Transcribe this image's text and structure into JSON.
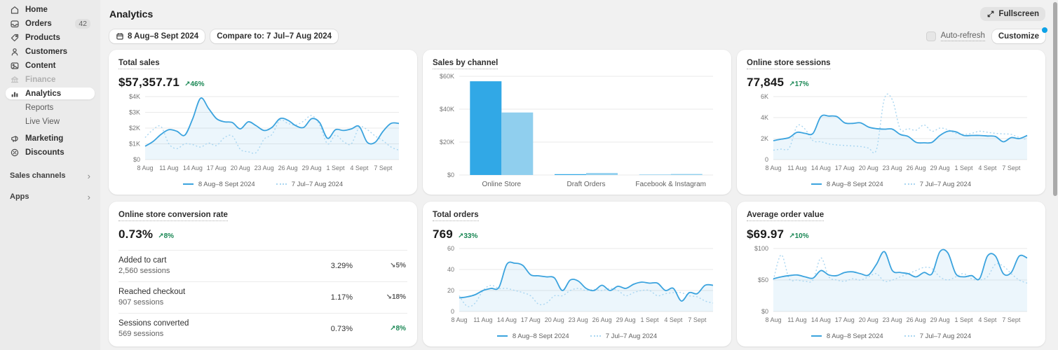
{
  "sidebar": {
    "items": [
      {
        "label": "Home"
      },
      {
        "label": "Orders",
        "badge": "42"
      },
      {
        "label": "Products"
      },
      {
        "label": "Customers"
      },
      {
        "label": "Content"
      },
      {
        "label": "Finance"
      },
      {
        "label": "Analytics"
      },
      {
        "label": "Reports"
      },
      {
        "label": "Live View"
      },
      {
        "label": "Marketing"
      },
      {
        "label": "Discounts"
      }
    ],
    "sections": [
      {
        "label": "Sales channels"
      },
      {
        "label": "Apps"
      }
    ]
  },
  "header": {
    "title": "Analytics",
    "fullscreen_label": "Fullscreen"
  },
  "toolbar": {
    "date_range": "8 Aug–8 Sept 2024",
    "compare_label": "Compare to: 7 Jul–7 Aug 2024",
    "auto_refresh_label": "Auto-refresh",
    "customize_label": "Customize"
  },
  "cards": [
    {
      "title": "Total sales",
      "value": "$57,357.71",
      "change": "↗46%",
      "dir": "up"
    },
    {
      "title": "Sales by channel"
    },
    {
      "title": "Online store sessions",
      "value": "77,845",
      "change": "↗17%",
      "dir": "up"
    },
    {
      "title": "Online store conversion rate",
      "value": "0.73%",
      "change": "↗8%",
      "dir": "up"
    },
    {
      "title": "Total orders",
      "value": "769",
      "change": "↗33%",
      "dir": "up"
    },
    {
      "title": "Average order value",
      "value": "$69.97",
      "change": "↗10%",
      "dir": "up"
    }
  ],
  "conversion": {
    "rows": [
      {
        "label": "Added to cart",
        "sessions": "2,560 sessions",
        "rate": "3.29%",
        "change": "↘5%",
        "dir": "down"
      },
      {
        "label": "Reached checkout",
        "sessions": "907 sessions",
        "rate": "1.17%",
        "change": "↘18%",
        "dir": "down"
      },
      {
        "label": "Sessions converted",
        "sessions": "569 sessions",
        "rate": "0.73%",
        "change": "↗8%",
        "dir": "up"
      }
    ]
  },
  "chart_data": [
    {
      "type": "line",
      "title": "Total sales",
      "grid": true,
      "legend": true,
      "ymax": 4000,
      "yticks": [
        4000,
        3000,
        2000,
        1000,
        0
      ],
      "ylabels": [
        "$4K",
        "$3K",
        "$2K",
        "$1K",
        "$0"
      ],
      "x_labels": [
        "8 Aug",
        "11 Aug",
        "14 Aug",
        "17 Aug",
        "20 Aug",
        "23 Aug",
        "26 Aug",
        "29 Aug",
        "1 Sept",
        "4 Sept",
        "7 Sept"
      ],
      "colors": {
        "current": "#3ba3de",
        "previous": "#a9d6f1",
        "fill": "rgba(64,166,222,0.10)"
      },
      "series": [
        {
          "name": "8 Aug–8 Sept 2024",
          "style": "solid",
          "values": [
            850,
            1150,
            1600,
            1900,
            1800,
            1550,
            2600,
            3900,
            3250,
            2600,
            2400,
            2350,
            1950,
            2400,
            2150,
            1850,
            2050,
            2600,
            2500,
            2150,
            2050,
            2600,
            2350,
            1350,
            1900,
            1850,
            1950,
            2100,
            1100,
            1100,
            1800,
            2300,
            2300
          ]
        },
        {
          "name": "7 Jul–7 Aug 2024",
          "style": "dotted",
          "values": [
            1400,
            1900,
            2100,
            1000,
            700,
            1000,
            950,
            800,
            1050,
            900,
            1400,
            1500,
            650,
            500,
            450,
            1300,
            1600,
            2500,
            2300,
            2200,
            2450,
            2800,
            2200,
            1000,
            1550,
            1150,
            1000,
            2050,
            1900,
            1500,
            1200,
            800,
            600
          ]
        }
      ]
    },
    {
      "type": "bar",
      "title": "Sales by channel",
      "grid": true,
      "legend": false,
      "ymax": 60000,
      "yticks": [
        60000,
        40000,
        20000,
        0
      ],
      "ylabels": [
        "$60K",
        "$40K",
        "$20K",
        "$0"
      ],
      "categories": [
        "Online Store",
        "Draft Orders",
        "Facebook & Instagram"
      ],
      "colors": {
        "current": "#31a8e6",
        "previous": "#90cfee"
      },
      "series": [
        {
          "name": "8 Aug–8 Sept 2024",
          "values": [
            57000,
            500,
            150
          ]
        },
        {
          "name": "7 Jul–7 Aug 2024",
          "values": [
            38000,
            1200,
            600
          ]
        }
      ]
    },
    {
      "type": "line",
      "title": "Online store sessions",
      "grid": true,
      "legend": true,
      "ymax": 6000,
      "yticks": [
        6000,
        4000,
        2000,
        0
      ],
      "ylabels": [
        "6K",
        "4K",
        "2K",
        "0"
      ],
      "x_labels": [
        "8 Aug",
        "11 Aug",
        "14 Aug",
        "17 Aug",
        "20 Aug",
        "23 Aug",
        "26 Aug",
        "29 Aug",
        "1 Sept",
        "4 Sept",
        "7 Sept"
      ],
      "colors": {
        "current": "#3ba3de",
        "previous": "#a9d6f1",
        "fill": "rgba(64,166,222,0.10)"
      },
      "series": [
        {
          "name": "8 Aug–8 Sept 2024",
          "style": "solid",
          "values": [
            1800,
            1950,
            2100,
            2600,
            2500,
            2500,
            4100,
            4150,
            4100,
            3500,
            3450,
            3500,
            3100,
            2950,
            2900,
            2900,
            2400,
            2200,
            1650,
            1600,
            1650,
            2300,
            2700,
            2650,
            2300,
            2300,
            2300,
            2250,
            2200,
            1700,
            2100,
            2000,
            2300
          ]
        },
        {
          "name": "7 Jul–7 Aug 2024",
          "style": "dotted",
          "values": [
            900,
            1000,
            1100,
            3200,
            2900,
            1800,
            1700,
            1500,
            1400,
            1350,
            1300,
            1250,
            1100,
            950,
            5800,
            5700,
            2900,
            2950,
            2800,
            3300,
            2700,
            3000,
            2850,
            2500,
            2400,
            2500,
            2700,
            2600,
            2500,
            2450,
            2400,
            2100,
            1900
          ]
        }
      ]
    },
    null,
    {
      "type": "line",
      "title": "Total orders",
      "grid": true,
      "legend": true,
      "ymax": 60,
      "yticks": [
        60,
        40,
        20,
        0
      ],
      "ylabels": [
        "60",
        "40",
        "20",
        "0"
      ],
      "x_labels": [
        "8 Aug",
        "11 Aug",
        "14 Aug",
        "17 Aug",
        "20 Aug",
        "23 Aug",
        "26 Aug",
        "29 Aug",
        "1 Sept",
        "4 Sept",
        "7 Sept"
      ],
      "colors": {
        "current": "#3ba3de",
        "previous": "#a9d6f1",
        "fill": "rgba(64,166,222,0.10)"
      },
      "series": [
        {
          "name": "8 Aug–8 Sept 2024",
          "style": "solid",
          "values": [
            13,
            14,
            16,
            20,
            22,
            23,
            45,
            46,
            44,
            35,
            34,
            33,
            32,
            20,
            30,
            29,
            22,
            20,
            25,
            20,
            24,
            22,
            26,
            28,
            27,
            27,
            20,
            22,
            10,
            18,
            17,
            25,
            25
          ]
        },
        {
          "name": "7 Jul–7 Aug 2024",
          "style": "dotted",
          "values": [
            15,
            5,
            8,
            20,
            25,
            22,
            22,
            20,
            18,
            15,
            7,
            8,
            15,
            15,
            20,
            22,
            20,
            21,
            20,
            22,
            20,
            15,
            18,
            20,
            20,
            15,
            17,
            18,
            18,
            15,
            14,
            10,
            8
          ]
        }
      ]
    },
    {
      "type": "line",
      "title": "Average order value",
      "grid": true,
      "legend": true,
      "ymax": 100,
      "yticks": [
        100,
        50,
        0
      ],
      "ylabels": [
        "$100",
        "$50",
        "$0"
      ],
      "x_labels": [
        "8 Aug",
        "11 Aug",
        "14 Aug",
        "17 Aug",
        "20 Aug",
        "23 Aug",
        "26 Aug",
        "29 Aug",
        "1 Sept",
        "4 Sept",
        "7 Sept"
      ],
      "colors": {
        "current": "#3ba3de",
        "previous": "#a9d6f1",
        "fill": "rgba(64,166,222,0.10)"
      },
      "series": [
        {
          "name": "8 Aug–8 Sept 2024",
          "style": "solid",
          "values": [
            52,
            55,
            57,
            58,
            55,
            53,
            65,
            58,
            57,
            62,
            63,
            60,
            58,
            75,
            95,
            65,
            62,
            60,
            55,
            62,
            60,
            95,
            93,
            60,
            55,
            57,
            52,
            88,
            88,
            60,
            62,
            88,
            85
          ]
        },
        {
          "name": "7 Jul–7 Aug 2024",
          "style": "dotted",
          "values": [
            50,
            90,
            52,
            50,
            48,
            50,
            85,
            55,
            50,
            48,
            52,
            50,
            55,
            60,
            48,
            50,
            55,
            60,
            65,
            70,
            68,
            55,
            50,
            55,
            60,
            52,
            50,
            55,
            75,
            72,
            60,
            50,
            45
          ]
        }
      ]
    }
  ]
}
